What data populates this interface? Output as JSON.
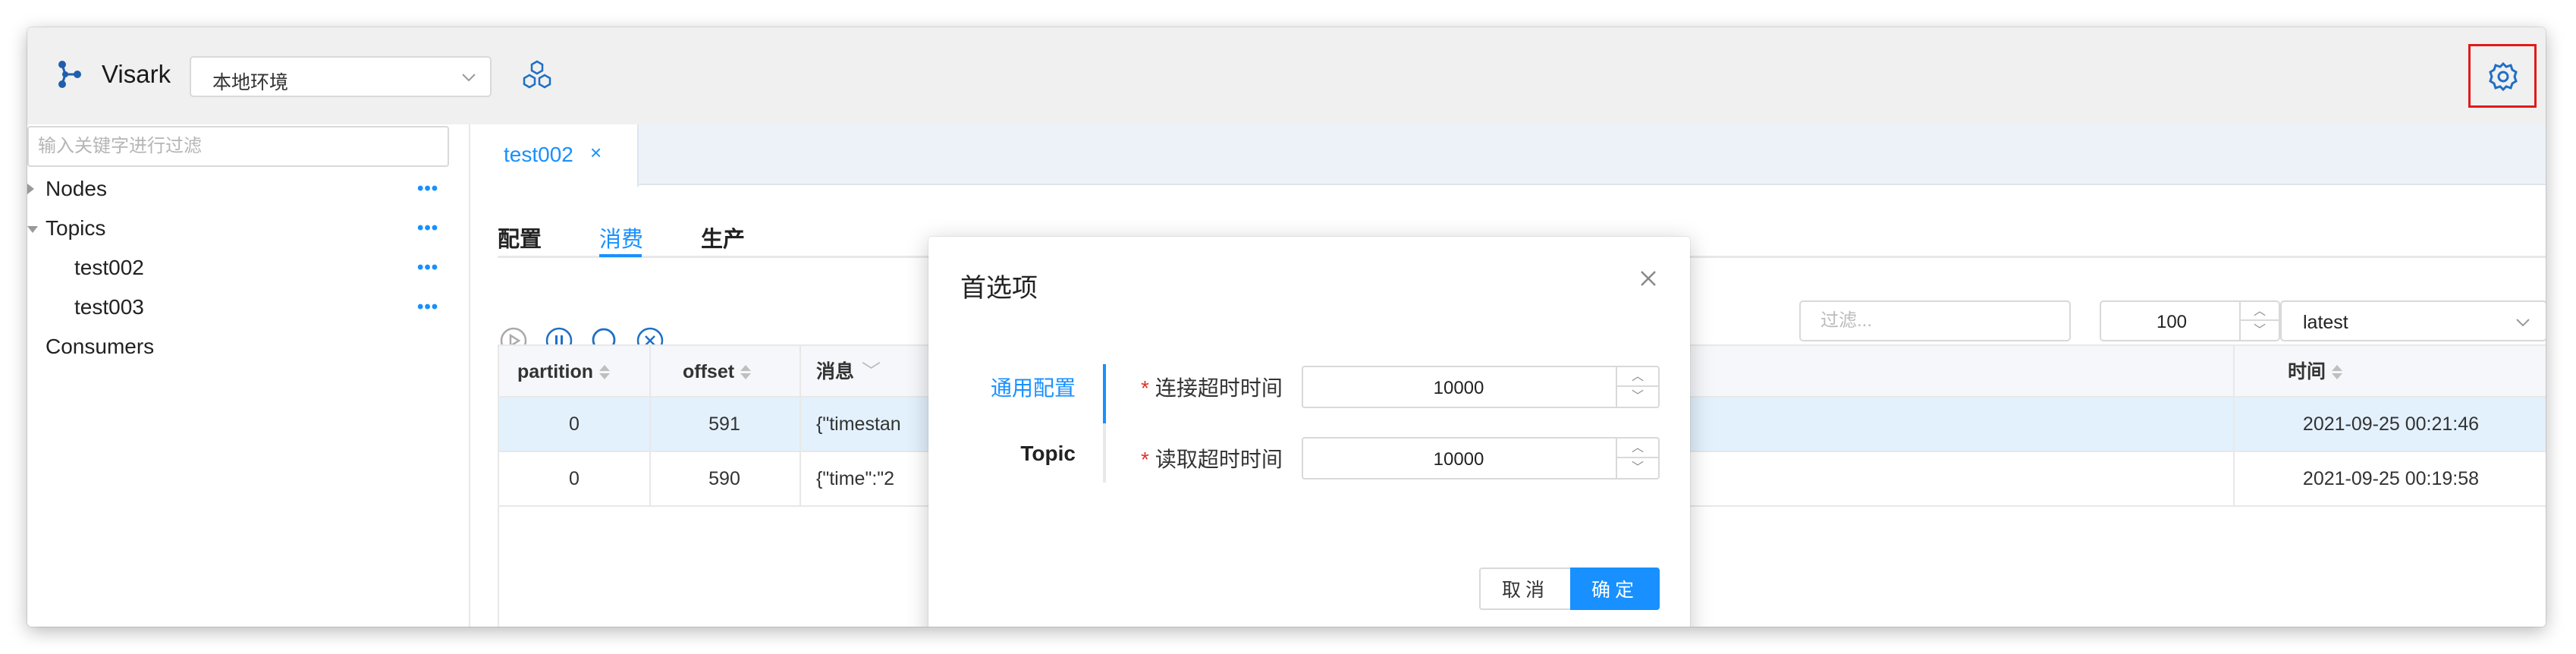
{
  "header": {
    "app_title": "Visark",
    "environment": "本地环境"
  },
  "sidebar": {
    "filter_placeholder": "输入关键字进行过滤",
    "tree": [
      {
        "label": "Nodes",
        "more": "•••"
      },
      {
        "label": "Topics",
        "more": "•••"
      },
      {
        "label": "test002",
        "more": "•••"
      },
      {
        "label": "test003",
        "more": "•••"
      },
      {
        "label": "Consumers"
      }
    ]
  },
  "main": {
    "open_tab": {
      "label": "test002",
      "close": "×"
    },
    "subtabs": [
      "配置",
      "消费",
      "生产"
    ],
    "active_subtab": "消费",
    "toolbar": {
      "filter_placeholder": "过滤...",
      "count": "100",
      "offset_mode": "latest"
    },
    "table": {
      "columns": [
        "partition",
        "offset",
        "消息",
        "时间"
      ],
      "rows": [
        {
          "partition": "0",
          "offset": "591",
          "message": "{\"timestan",
          "time": "2021-09-25 00:21:46",
          "selected": true
        },
        {
          "partition": "0",
          "offset": "590",
          "message": "{\"time\":\"2",
          "time": "2021-09-25 00:19:58",
          "selected": false
        }
      ]
    }
  },
  "modal": {
    "title": "首选项",
    "nav": [
      {
        "label": "通用配置",
        "active": true
      },
      {
        "label": "Topic",
        "active": false
      }
    ],
    "fields": [
      {
        "label": "连接超时时间",
        "value": "10000",
        "required": true
      },
      {
        "label": "读取超时时间",
        "value": "10000",
        "required": true
      }
    ],
    "cancel_label": "取消",
    "ok_label": "确定"
  },
  "colors": {
    "accent": "#1890ff",
    "highlight_row": "#e3f1fd",
    "required": "#e0312b",
    "settings_outline": "#e01b1b"
  }
}
